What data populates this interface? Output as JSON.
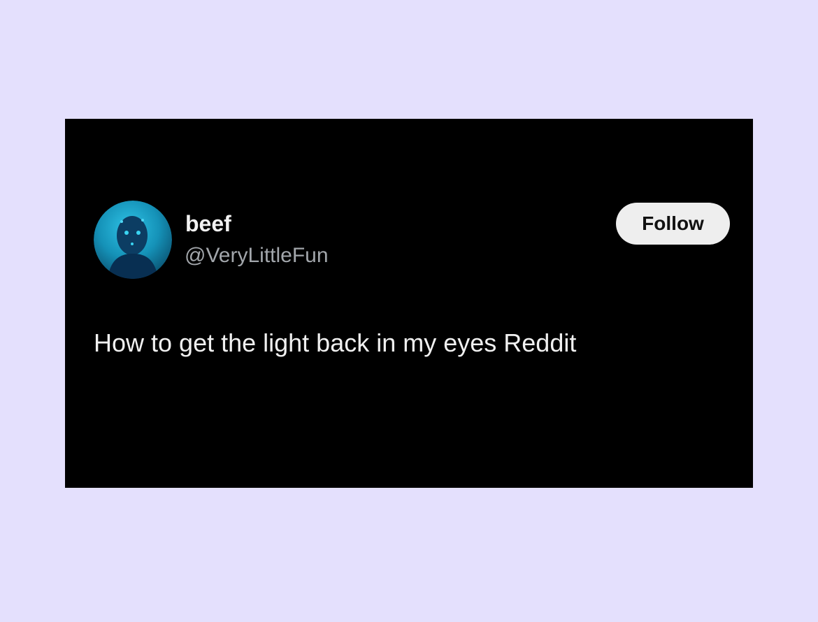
{
  "tweet": {
    "display_name": "beef",
    "handle": "@VeryLittleFun",
    "follow_label": "Follow",
    "text": "How to get the light back in my eyes Reddit",
    "avatar_icon": "profile-photo-icon"
  },
  "colors": {
    "page_background": "#e4e0fd",
    "card_background": "#000000",
    "avatar_accent": "#1aa3c7",
    "follow_button_background": "#eeeeee"
  }
}
